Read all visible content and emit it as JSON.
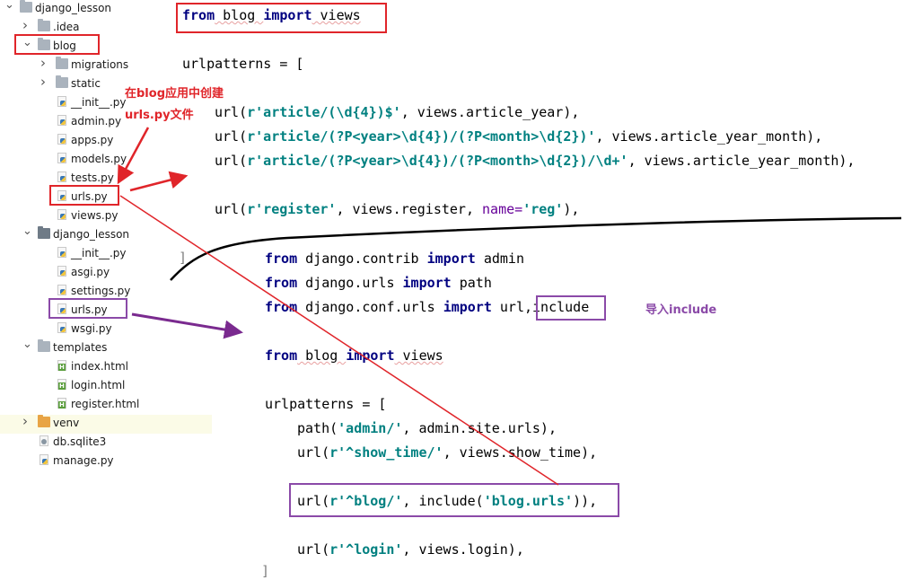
{
  "tree": {
    "items": [
      {
        "label": "django_lesson",
        "type": "folder",
        "expanded": true
      },
      {
        "label": ".idea",
        "type": "folder",
        "expanded": false
      },
      {
        "label": "blog",
        "type": "folder",
        "expanded": true
      },
      {
        "label": "migrations",
        "type": "folder",
        "expanded": false
      },
      {
        "label": "static",
        "type": "folder",
        "expanded": false
      },
      {
        "label": "__init__.py",
        "type": "py"
      },
      {
        "label": "admin.py",
        "type": "py"
      },
      {
        "label": "apps.py",
        "type": "py"
      },
      {
        "label": "models.py",
        "type": "py"
      },
      {
        "label": "tests.py",
        "type": "py"
      },
      {
        "label": "urls.py",
        "type": "py"
      },
      {
        "label": "views.py",
        "type": "py"
      },
      {
        "label": "django_lesson",
        "type": "folder",
        "expanded": true
      },
      {
        "label": "__init__.py",
        "type": "py"
      },
      {
        "label": "asgi.py",
        "type": "py"
      },
      {
        "label": "settings.py",
        "type": "py"
      },
      {
        "label": "urls.py",
        "type": "py"
      },
      {
        "label": "wsgi.py",
        "type": "py"
      },
      {
        "label": "templates",
        "type": "folder",
        "expanded": true
      },
      {
        "label": "index.html",
        "type": "html"
      },
      {
        "label": "login.html",
        "type": "html"
      },
      {
        "label": "register.html",
        "type": "html"
      },
      {
        "label": "venv",
        "type": "folder",
        "expanded": false
      },
      {
        "label": "db.sqlite3",
        "type": "db"
      },
      {
        "label": "manage.py",
        "type": "py"
      }
    ]
  },
  "blog_urls": {
    "l1": {
      "a": "from",
      "b": " blog ",
      "c": "import",
      "d": " views"
    },
    "l2": "urlpatterns = [",
    "l3": {
      "a": "url(",
      "b": "r'article/(\\d{4})$'",
      "c": ", views.article_year),"
    },
    "l4": {
      "a": "url(",
      "b": "r'article/(?P<year>\\d{4})/(?P<month>\\d{2})'",
      "c": ", views.article_year_month),"
    },
    "l5": {
      "a": "url(",
      "b": "r'article/(?P<year>\\d{4})/(?P<month>\\d{2})/\\d+'",
      "c": ", views.article_year_month),"
    },
    "l6": {
      "a": "url(",
      "b": "r'register'",
      "c": ", views.register, ",
      "d": "name=",
      "e": "'reg'",
      "f": "),"
    },
    "l7": "]"
  },
  "project_urls": {
    "l1": {
      "a": "from",
      "b": " django.contrib ",
      "c": "import",
      "d": " admin"
    },
    "l2": {
      "a": "from",
      "b": " django.urls ",
      "c": "import",
      "d": " path"
    },
    "l3": {
      "a": "from",
      "b": " django.conf.urls ",
      "c": "import",
      "d": " url,",
      "e": "include"
    },
    "l4": {
      "a": "from",
      "b": " blog ",
      "c": "import",
      "d": " views"
    },
    "l5": "urlpatterns = [",
    "l6": {
      "a": "path(",
      "b": "'admin/'",
      "c": ", admin.site.urls),"
    },
    "l7": {
      "a": "url(",
      "b": "r'^show_time/'",
      "c": ", views.show_time),"
    },
    "l8": {
      "a": "url(",
      "b": "r'^blog/'",
      "c": ", include(",
      "d": "'blog.urls'",
      "e": ")),"
    },
    "l9": {
      "a": "url(",
      "b": "r'^login'",
      "c": ", views.login),"
    },
    "l10": "]"
  },
  "annotations": {
    "create_note_line1": "在blog应用中创建",
    "create_note_line2": "urls.py文件",
    "include_note": "导入include"
  },
  "colors": {
    "red": "#e0252a",
    "purple": "#8b4aa8",
    "keyword": "#000080",
    "string": "#008080"
  }
}
